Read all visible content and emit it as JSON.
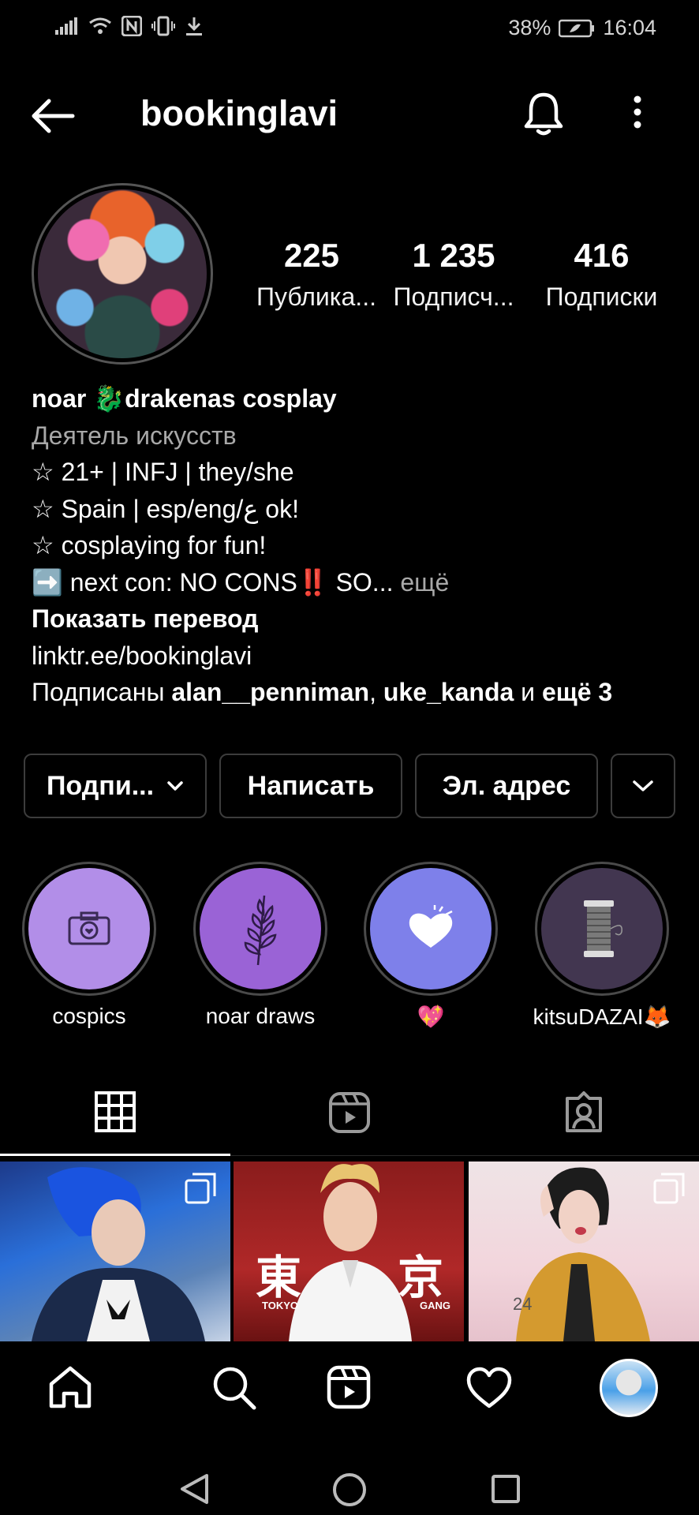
{
  "status_bar": {
    "battery": "38%",
    "time": "16:04"
  },
  "header": {
    "username": "bookinglavi"
  },
  "stats": [
    {
      "value": "225",
      "label": "Публика..."
    },
    {
      "value": "1 235",
      "label": "Подписч..."
    },
    {
      "value": "416",
      "label": "Подписки"
    }
  ],
  "bio": {
    "name": "noar 🐉drakenas cosplay",
    "category": "Деятель искусств",
    "lines": [
      "☆ 21+ | INFJ | they/she",
      "☆ Spain | esp/eng/ع ok!",
      "☆ cosplaying for fun!"
    ],
    "next_con": "➡️ next con: NO CONS‼️ SO...",
    "more": "ещё",
    "show_translation": "Показать перевод",
    "link": "linktr.ee/bookinglavi",
    "followed_prefix": "Подписаны ",
    "followed_user1": "alan__penniman",
    "followed_sep": ", ",
    "followed_user2": "uke_kanda",
    "followed_and": " и ",
    "followed_more": "ещё 3"
  },
  "buttons": {
    "follow": "Подпи...",
    "message": "Написать",
    "email": "Эл. адрес"
  },
  "highlights": [
    {
      "label": "cospics",
      "color": "#b28ee8",
      "icon": "camera-icon"
    },
    {
      "label": "noar draws",
      "color": "#9a63d6",
      "icon": "leaf-icon"
    },
    {
      "label": "💖",
      "color": "#7e80ea",
      "icon": "heart-icon"
    },
    {
      "label": "kitsuDAZAI🦊",
      "color": "#423650",
      "icon": "thread-spool-icon"
    }
  ],
  "tabs": [
    "grid-tab",
    "reels-tab",
    "tagged-tab"
  ],
  "posts": [
    {
      "caption_left": "",
      "caption_right": ""
    },
    {
      "caption_left": "TOKYO",
      "caption_right": "GANG",
      "glyph_left": "東",
      "glyph_right": "京"
    },
    {
      "number": "24"
    }
  ],
  "colors": {
    "background": "#000000",
    "text": "#ffffff",
    "muted": "#a8a8a8",
    "border": "#3c3c3c"
  }
}
